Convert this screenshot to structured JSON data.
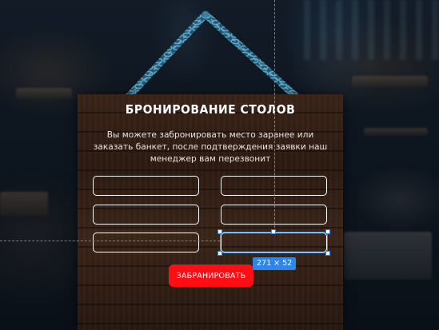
{
  "booking_form": {
    "title": "БРОНИРОВАНИЕ СТОЛОВ",
    "description": "Вы можете забронировать место заранее или заказать банкет, после подтверждения заявки наш менеджер вам перезвонит",
    "fields": [
      "",
      "",
      "",
      "",
      "",
      ""
    ],
    "submit_label": "ЗАБРАНИРОВАТЬ"
  },
  "editor": {
    "selection_size": "271 × 52"
  },
  "colors": {
    "accent": "#ff0d14",
    "selection": "#2f86e8"
  }
}
